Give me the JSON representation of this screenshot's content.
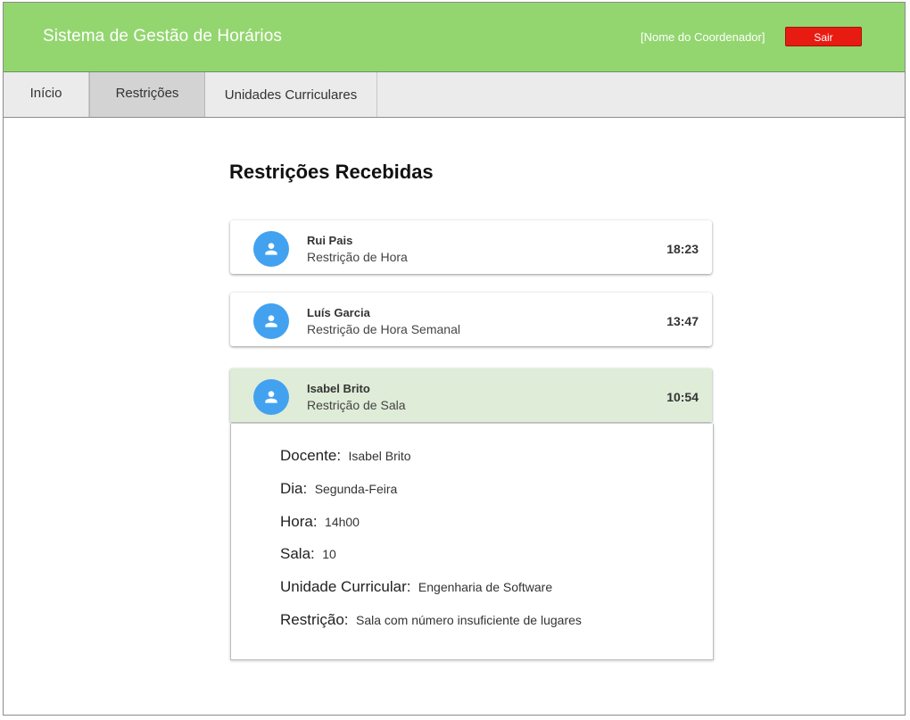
{
  "header": {
    "app_title": "Sistema de Gestão de Horários",
    "user_name": "[Nome do Coordenador]",
    "logout_label": "Sair"
  },
  "tabs": [
    {
      "label": "Início",
      "active": false
    },
    {
      "label": "Restrições",
      "active": true
    },
    {
      "label": "Unidades Curriculares",
      "active": false
    }
  ],
  "main": {
    "heading": "Restrições Recebidas",
    "restrictions": [
      {
        "name": "Rui Pais",
        "type": "Restrição de Hora",
        "time": "18:23",
        "icon": "person-icon"
      },
      {
        "name": "Luís Garcia",
        "type": "Restrição de Hora Semanal",
        "time": "13:47",
        "icon": "person-icon"
      },
      {
        "name": "Isabel Brito",
        "type": "Restrição de Sala",
        "time": "10:54",
        "icon": "person-icon",
        "expanded": true
      }
    ],
    "details": [
      {
        "label": "Docente:",
        "value": "Isabel Brito"
      },
      {
        "label": "Dia:",
        "value": "Segunda-Feira"
      },
      {
        "label": "Hora:",
        "value": "14h00"
      },
      {
        "label": "Sala:",
        "value": "10"
      },
      {
        "label": "Unidade Curricular:",
        "value": "Engenharia de Software"
      },
      {
        "label": "Restrição:",
        "value": "Sala com número insuficiente de lugares"
      }
    ]
  },
  "colors": {
    "header_bg": "#93d66f",
    "logout_bg": "#e81b12",
    "avatar_bg": "#42a2f0",
    "selected_card_bg": "#dfecd8"
  }
}
